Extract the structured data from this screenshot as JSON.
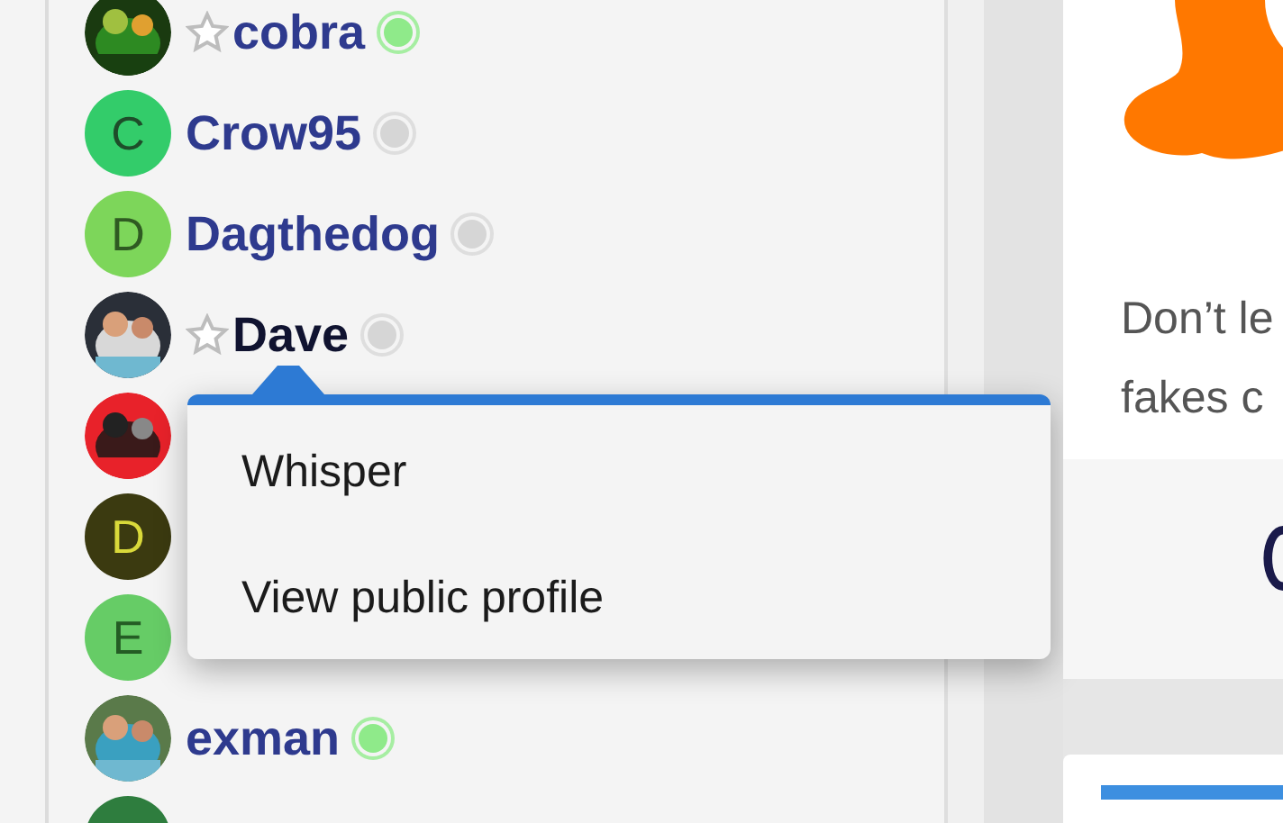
{
  "users": [
    {
      "name": "cobra",
      "avatar": {
        "kind": "picture"
      },
      "starred": true,
      "online": true,
      "selected": false
    },
    {
      "name": "Crow95",
      "avatar": {
        "kind": "letter",
        "color": "#33cc6a",
        "letter": {
          "text": "C",
          "color": "#1e4d2a"
        }
      },
      "starred": false,
      "online": false,
      "selected": false
    },
    {
      "name": "Dagthedog",
      "avatar": {
        "kind": "letter",
        "color": "#7dd65a",
        "letter": {
          "text": "D",
          "color": "#2f5a22"
        }
      },
      "starred": false,
      "online": false,
      "selected": false
    },
    {
      "name": "Dave",
      "avatar": {
        "kind": "picture"
      },
      "starred": true,
      "online": false,
      "selected": true
    },
    {
      "avatar": {
        "kind": "picture"
      }
    },
    {
      "avatar": {
        "kind": "letter",
        "color": "#3b3a10",
        "letter": {
          "text": "D",
          "color": "#d9d93a"
        }
      }
    },
    {
      "avatar": {
        "kind": "letter",
        "color": "#66cc66",
        "letter": {
          "text": "E",
          "color": "#245c24"
        }
      }
    },
    {
      "name": "exman",
      "avatar": {
        "kind": "picture"
      },
      "starred": false,
      "online": true,
      "selected": false
    },
    {
      "avatar": {
        "kind": "letter",
        "color": "#2e7d3e"
      }
    }
  ],
  "context_menu": {
    "items": [
      "Whisper",
      "View public profile"
    ]
  },
  "promo": {
    "lines": [
      "Don’t le",
      "fakes c"
    ]
  }
}
